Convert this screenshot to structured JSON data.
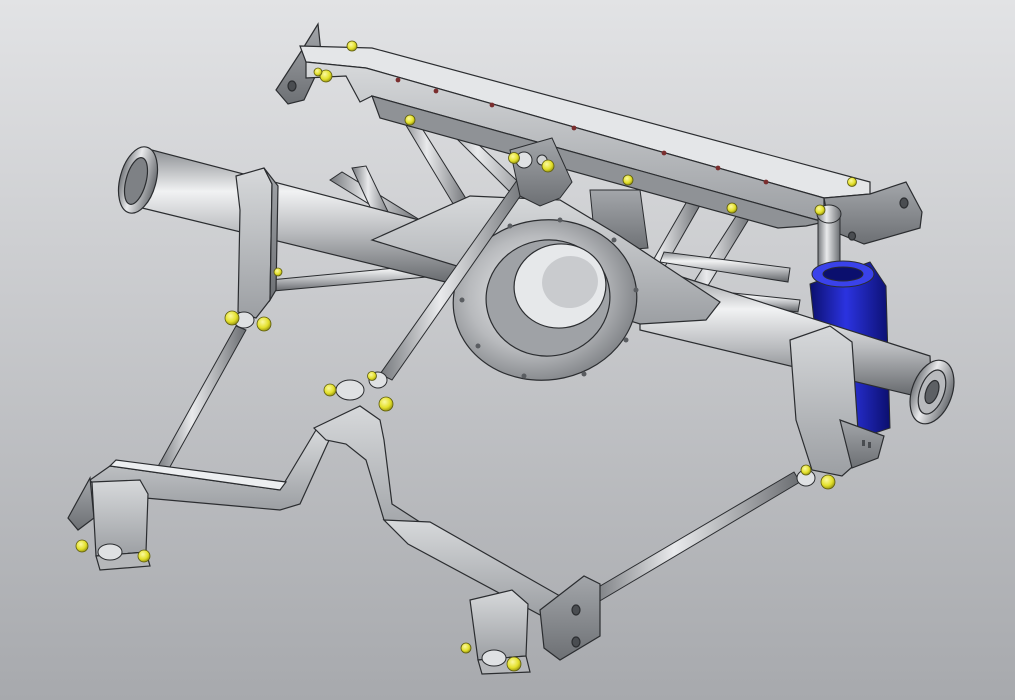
{
  "scene": {
    "subject": "rear-suspension-assembly",
    "view": "isometric-3d-cad",
    "background_top": "#e2e3e5",
    "background_bottom": "#a7a9ad",
    "part_color": "#c4c6c9",
    "part_dark": "#6f7276",
    "part_light": "#eef0f2",
    "edge_color": "#2b2d30",
    "shock_color": "#1c22c8",
    "shock_dark": "#0b0f6e",
    "fastener_color": "#e3e02a"
  }
}
